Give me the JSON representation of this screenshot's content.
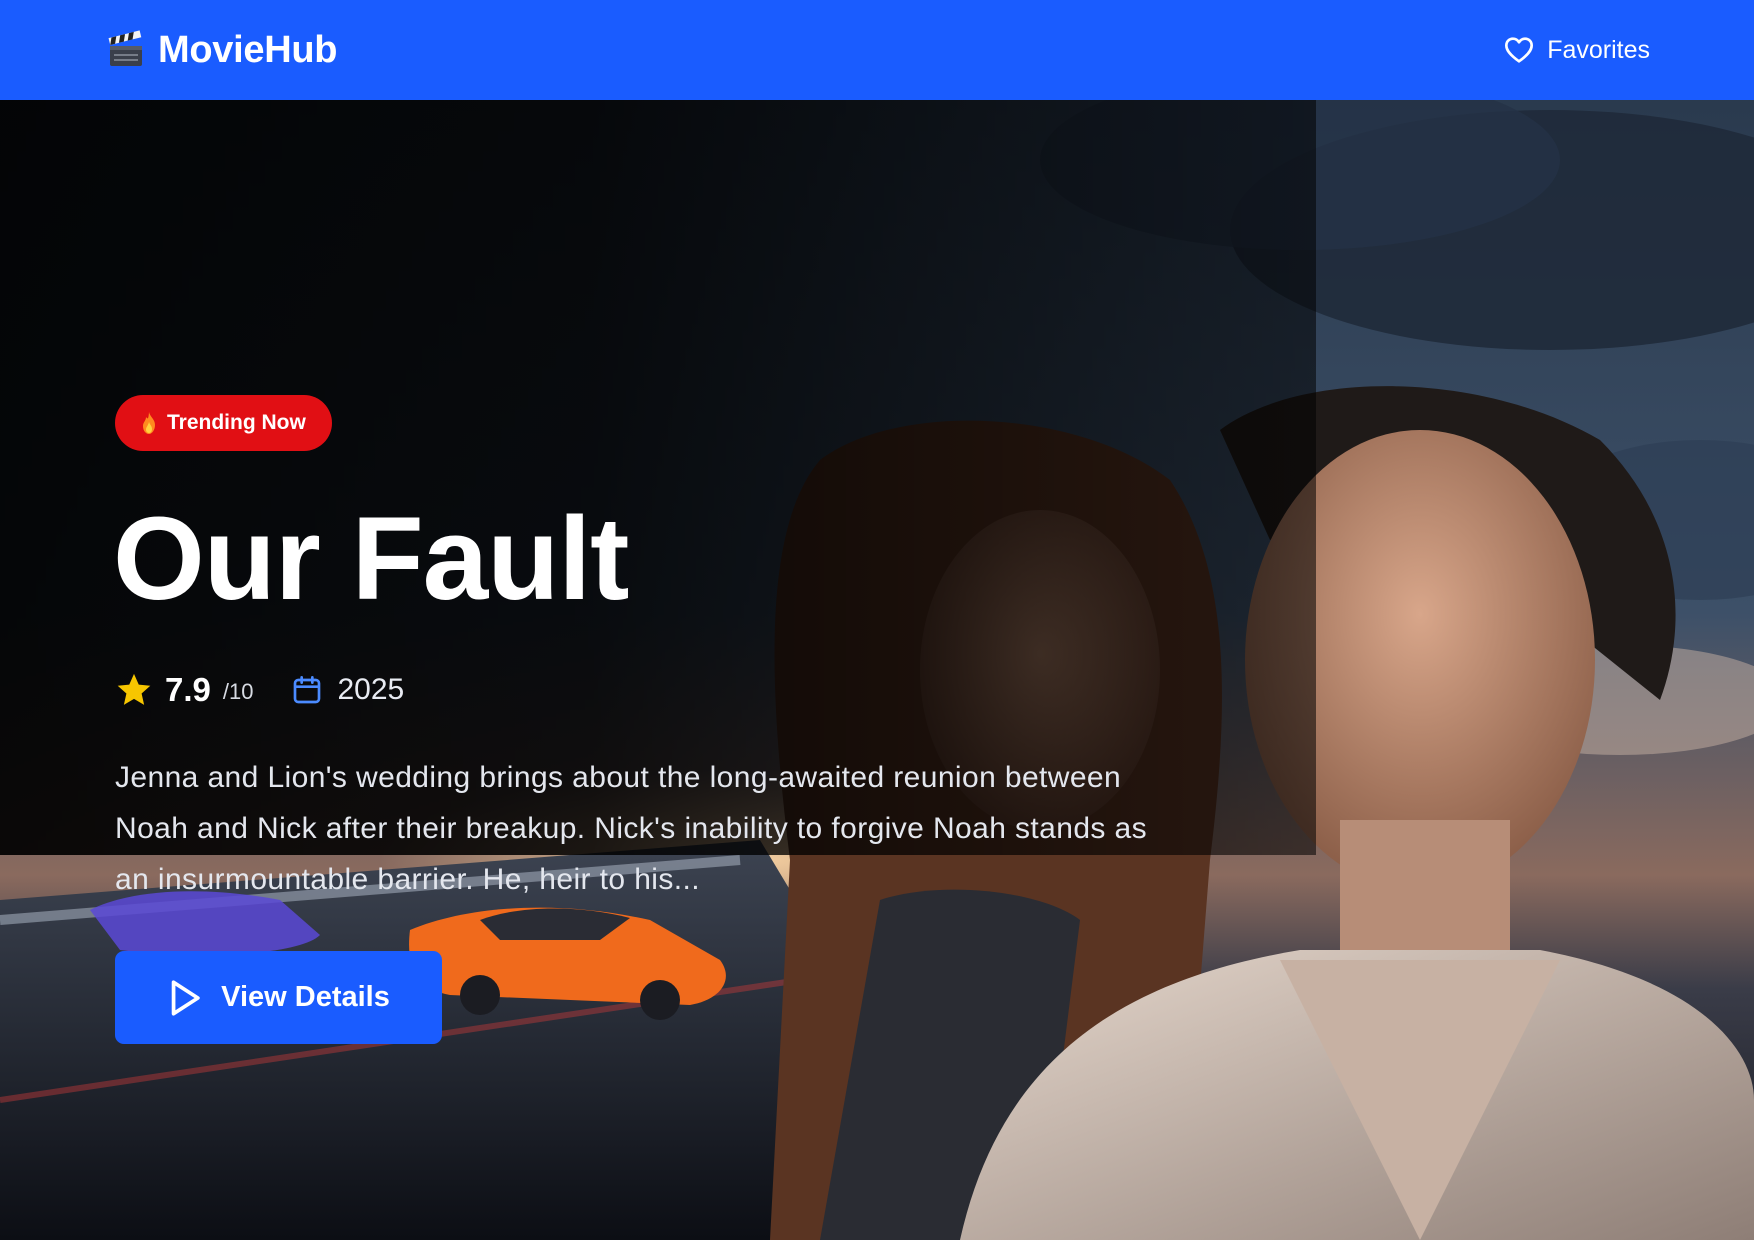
{
  "app": {
    "name": "MovieHub"
  },
  "nav": {
    "favorites_label": "Favorites"
  },
  "hero": {
    "badge": "Trending Now",
    "title": "Our Fault",
    "rating": "7.9",
    "rating_max": "/10",
    "year": "2025",
    "description": "Jenna and Lion's wedding brings about the long-awaited reunion between Noah and Nick after their breakup. Nick's inability to forgive Noah stands as an insurmountable barrier. He, heir to his...",
    "cta_label": "View Details"
  },
  "icons": {
    "brand": "clapperboard-icon",
    "favorites": "heart-icon",
    "badge": "fire-icon",
    "rating": "star-icon",
    "year": "calendar-icon",
    "cta": "play-icon"
  },
  "colors": {
    "primary": "#1a5cff",
    "badge": "#e10f14",
    "star": "#f7c600",
    "calendar": "#4b8bff",
    "text": "#ffffff"
  }
}
